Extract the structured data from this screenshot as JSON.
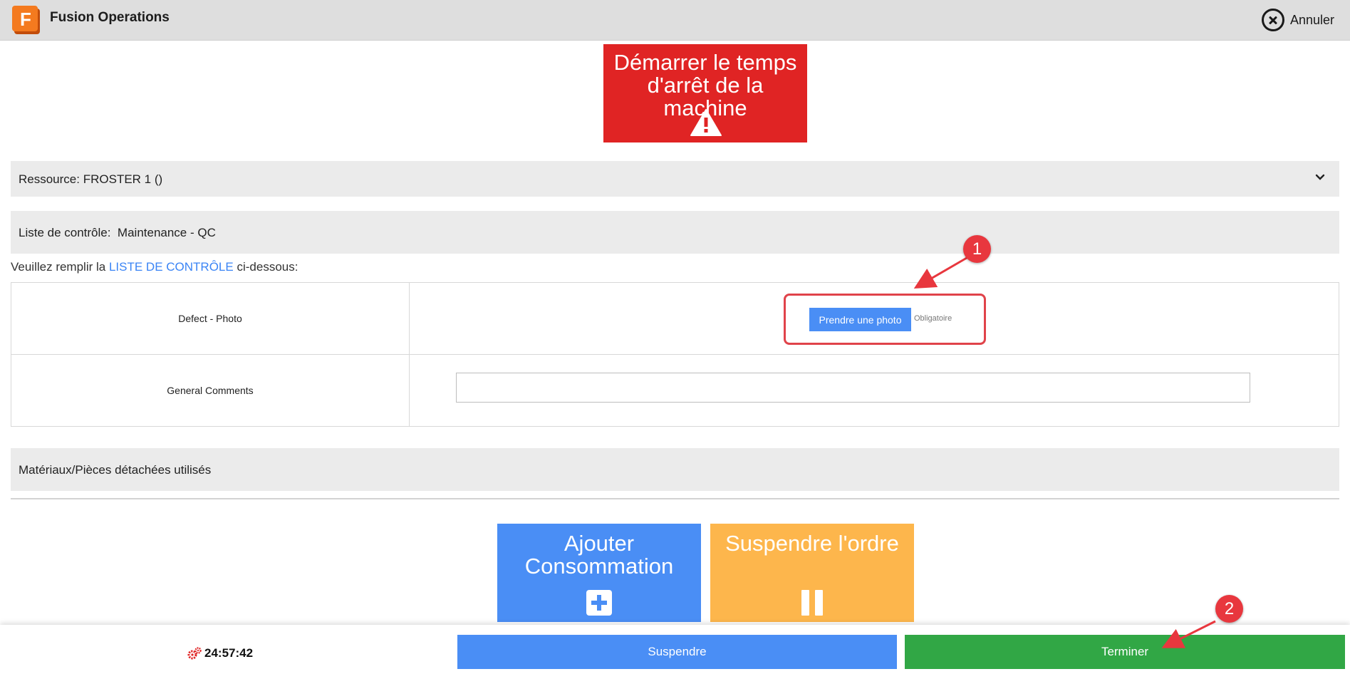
{
  "app": {
    "title": "Fusion Operations",
    "cancel_label": "Annuler"
  },
  "downtime": {
    "label": "Démarrer le temps d'arrêt de la machine"
  },
  "resource": {
    "label": "Ressource:",
    "value": "FROSTER 1 ()"
  },
  "checklist": {
    "label": "Liste de contrôle:",
    "value": "Maintenance - QC"
  },
  "instruction": {
    "prefix": "Veuillez remplir la",
    "link": "LISTE DE CONTRÔLE",
    "suffix": "ci-dessous:"
  },
  "checklist_items": [
    {
      "label": "Defect - Photo",
      "button": "Prendre une photo",
      "note": "Obligatoire"
    },
    {
      "label": "General Comments",
      "value": ""
    }
  ],
  "materials": {
    "label": "Matériaux/Pièces détachées utilisés"
  },
  "tiles": {
    "add": {
      "label": "Ajouter Consommation"
    },
    "suspend_order": {
      "label": "Suspendre l'ordre"
    }
  },
  "footer": {
    "timer": "24:57:42",
    "suspend_label": "Suspendre",
    "finish_label": "Terminer"
  },
  "annotations": {
    "marker1": "1",
    "marker2": "2"
  },
  "colors": {
    "red": "#e02424",
    "blue": "#4a8ef5",
    "orange": "#fdb64c",
    "green": "#31a745",
    "annotation": "#e8373e"
  }
}
